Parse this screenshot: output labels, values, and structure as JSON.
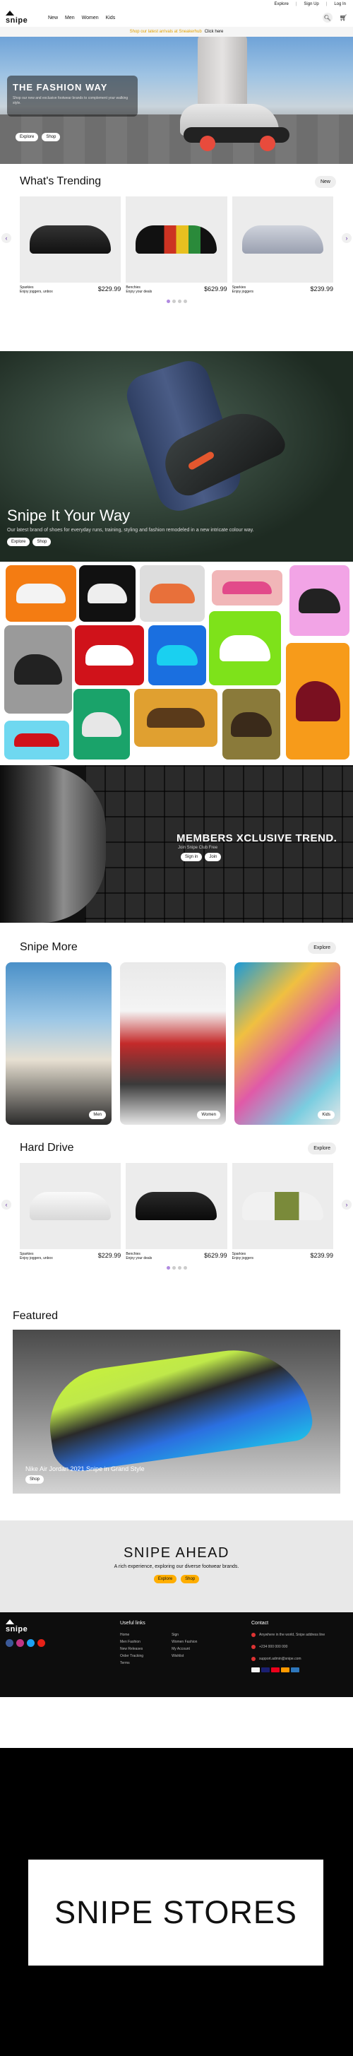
{
  "topbar": {
    "links": [
      "Explore",
      "Sign Up",
      "Log In"
    ]
  },
  "nav": {
    "logo_text": "snipe",
    "links": [
      "New",
      "Men",
      "Women",
      "Kids"
    ],
    "search_icon": "search-icon",
    "cart_icon": "cart-icon"
  },
  "promo": {
    "text": "Shop our latest arrivals at Sneakerhub",
    "cta": "Click here"
  },
  "hero1": {
    "title": "THE FASHION WAY",
    "subtitle": "Shop our new and exclusive footwear brands to complement your walking style.",
    "buttons": [
      "Explore",
      "Shop"
    ]
  },
  "trending": {
    "title": "What's Trending",
    "tag": "New",
    "products": [
      {
        "name": "Sparkies",
        "desc": "Enjoy joggers, unbox",
        "price": "$229.99"
      },
      {
        "name": "Benchies",
        "desc": "Enjoy your deals",
        "price": "$629.99"
      },
      {
        "name": "Sparkies",
        "desc": "Enjoy joggers",
        "price": "$239.99"
      }
    ]
  },
  "hero2": {
    "title": "Snipe It Your Way",
    "subtitle": "Our latest brand of shoes for everyday runs, training, styling and fashion remodeled in a new intricate colour way.",
    "buttons": [
      "Explore",
      "Shop"
    ]
  },
  "members": {
    "title": "MEMBERS XCLUSIVE TREND.",
    "subtitle": "Join Snipe Club Free",
    "buttons": [
      "Sign in",
      "Join"
    ]
  },
  "snipemore": {
    "title": "Snipe More",
    "tag": "Explore",
    "categories": [
      "Men",
      "Women",
      "Kids"
    ]
  },
  "harddrive": {
    "title": "Hard Drive",
    "tag": "Explore",
    "products": [
      {
        "name": "Sparkies",
        "desc": "Enjoy joggers, unbox",
        "price": "$229.99"
      },
      {
        "name": "Benchies",
        "desc": "Enjoy your deals",
        "price": "$629.99"
      },
      {
        "name": "Sparkies",
        "desc": "Enjoy joggers",
        "price": "$239.99"
      }
    ]
  },
  "featured": {
    "title": "Featured",
    "caption": "Nike Air Jordan 2021 Snipe in Grand Style",
    "button": "Shop"
  },
  "ahead": {
    "title": "SNIPE AHEAD",
    "subtitle": "A rich experience, exploring our diverse footwear brands.",
    "buttons": [
      "Explore",
      "Shop"
    ]
  },
  "footer": {
    "logo_text": "snipe",
    "links_title": "Useful links",
    "links_col1": [
      "Home",
      "Men Fashion",
      "New Releases",
      "Order Tracking",
      "Terms"
    ],
    "links_col2": [
      "Sign",
      "Women Fashion",
      "My Account",
      "Wishlist"
    ],
    "contact_title": "Contact",
    "contact": [
      "Anywhere in the world, Snipe address line",
      "+234 000 000 000",
      "support.admin@snipe.com"
    ],
    "social_colors": [
      "#3b5998",
      "#c13584",
      "#1da1f2",
      "#e62117"
    ],
    "payment_colors": [
      "#f4f4f4",
      "#1a1f71",
      "#eb001b",
      "#ff9900",
      "#2e77bc"
    ]
  },
  "stores": {
    "title": "SNIPE STORES"
  }
}
